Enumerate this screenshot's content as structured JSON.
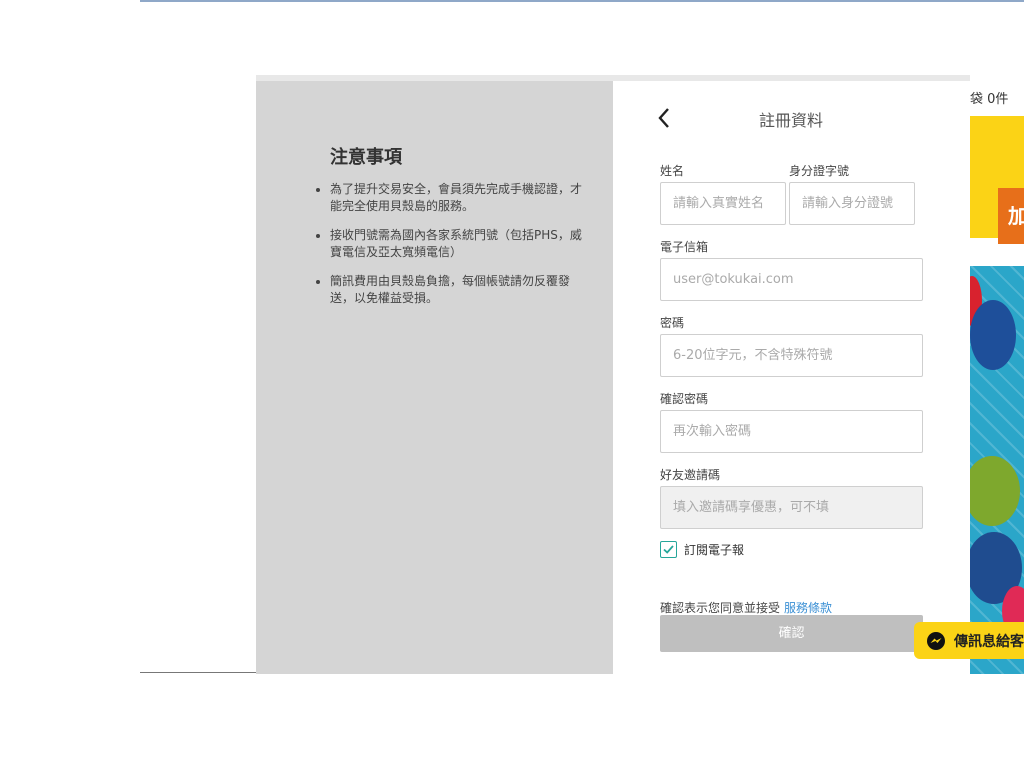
{
  "background_page": {
    "cart_label": "袋 0件",
    "join_button": "加"
  },
  "notice": {
    "title": "注意事項",
    "items": [
      "為了提升交易安全，會員須先完成手機認證，才能完全使用貝殼島的服務。",
      "接收門號需為國內各家系統門號（包括PHS，威寶電信及亞太寬頻電信）",
      "簡訊費用由貝殼島負擔，每個帳號請勿反覆發送，以免權益受損。"
    ]
  },
  "form": {
    "title": "註冊資料",
    "name_label": "姓名",
    "name_placeholder": "請輸入真實姓名",
    "id_label": "身分證字號",
    "id_placeholder": "請輸入身分證號",
    "email_label": "電子信箱",
    "email_placeholder": "user@tokukai.com",
    "password_label": "密碼",
    "password_placeholder": "6-20位字元，不含特殊符號",
    "confirm_password_label": "確認密碼",
    "confirm_password_placeholder": "再次輸入密碼",
    "referral_label": "好友邀請碼",
    "referral_placeholder": "填入邀請碼享優惠，可不填",
    "newsletter_label": "訂閱電子報",
    "newsletter_checked": true,
    "terms_text": "確認表示您同意並接受",
    "terms_link": "服務條款",
    "confirm_button": "確認"
  },
  "messenger": {
    "label": "傳訊息給客"
  },
  "colors": {
    "accent_yellow": "#fbd316",
    "checkbox_teal": "#26a69a",
    "link_blue": "#3a8fd4",
    "confirm_disabled": "#bfbfbf"
  }
}
